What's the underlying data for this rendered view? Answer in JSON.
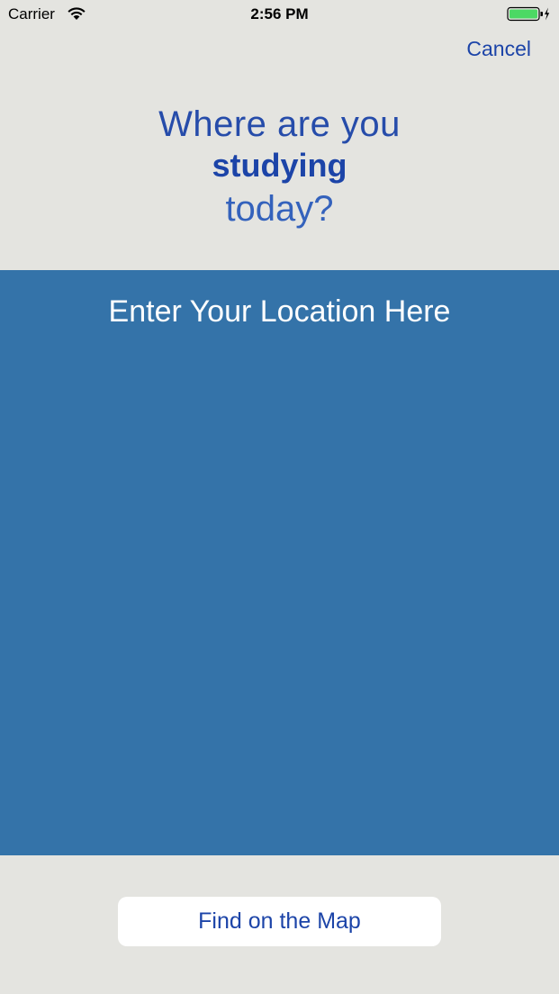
{
  "status_bar": {
    "carrier": "Carrier",
    "time": "2:56 PM",
    "wifi_icon": "wifi-icon",
    "battery_icon": "battery-charging-icon",
    "battery_color": "#4cd964"
  },
  "header": {
    "cancel_label": "Cancel",
    "question": {
      "line1": "Where are you",
      "line2": "studying",
      "line3": "today?"
    }
  },
  "location": {
    "placeholder": "Enter Your Location Here",
    "value": ""
  },
  "footer": {
    "find_button_label": "Find on the Map"
  },
  "colors": {
    "accent": "#1c44a8",
    "panel": "#3473a9",
    "background": "#e4e4e0"
  }
}
